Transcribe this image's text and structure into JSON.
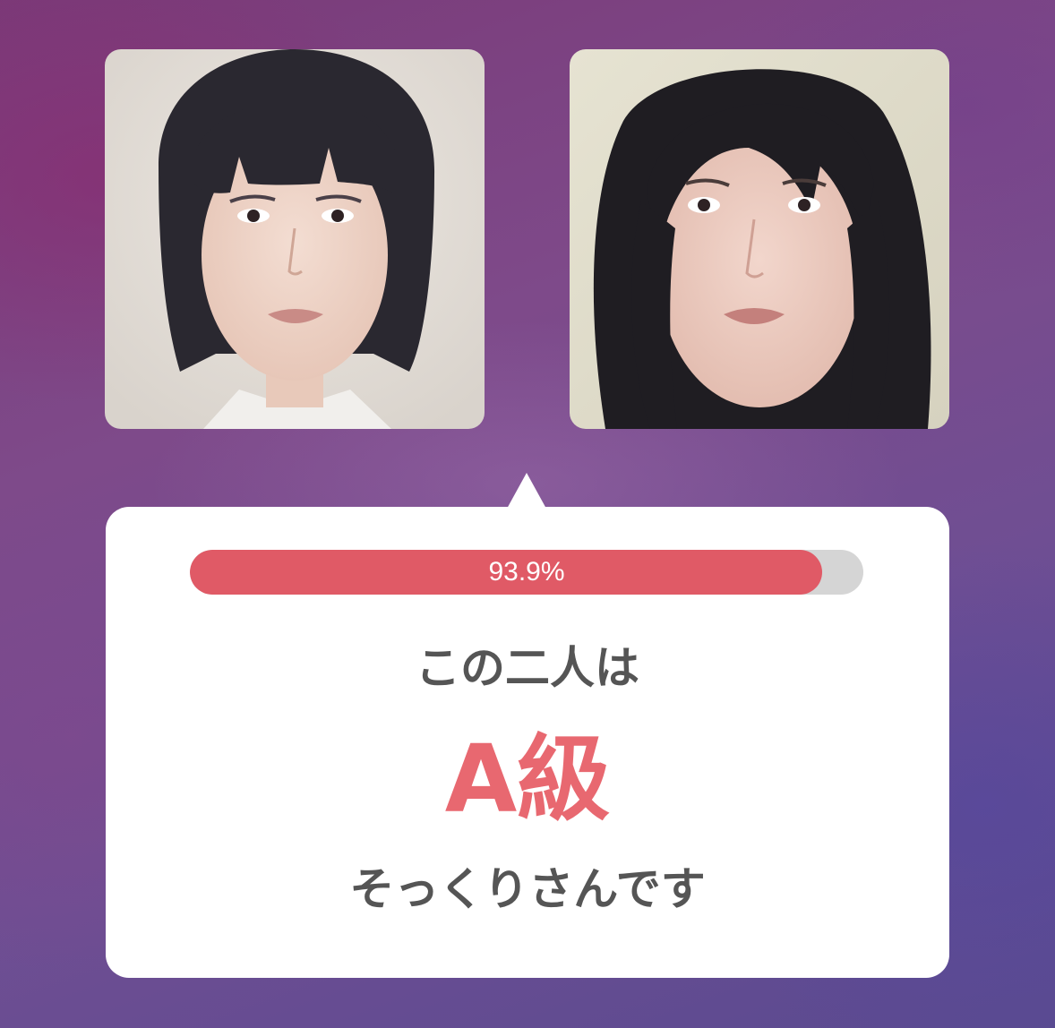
{
  "photos": {
    "left": {
      "name": "portrait-short-hair"
    },
    "right": {
      "name": "portrait-long-hair"
    }
  },
  "result": {
    "similarity_percent": 93.9,
    "similarity_label": "93.9%",
    "line1": "この二人は",
    "grade": "A級",
    "line3": "そっくりさんです"
  },
  "colors": {
    "accent": "#e05a66",
    "grade_text": "#e86870",
    "body_text": "#555555",
    "track": "#d5d5d5",
    "card": "#ffffff"
  }
}
